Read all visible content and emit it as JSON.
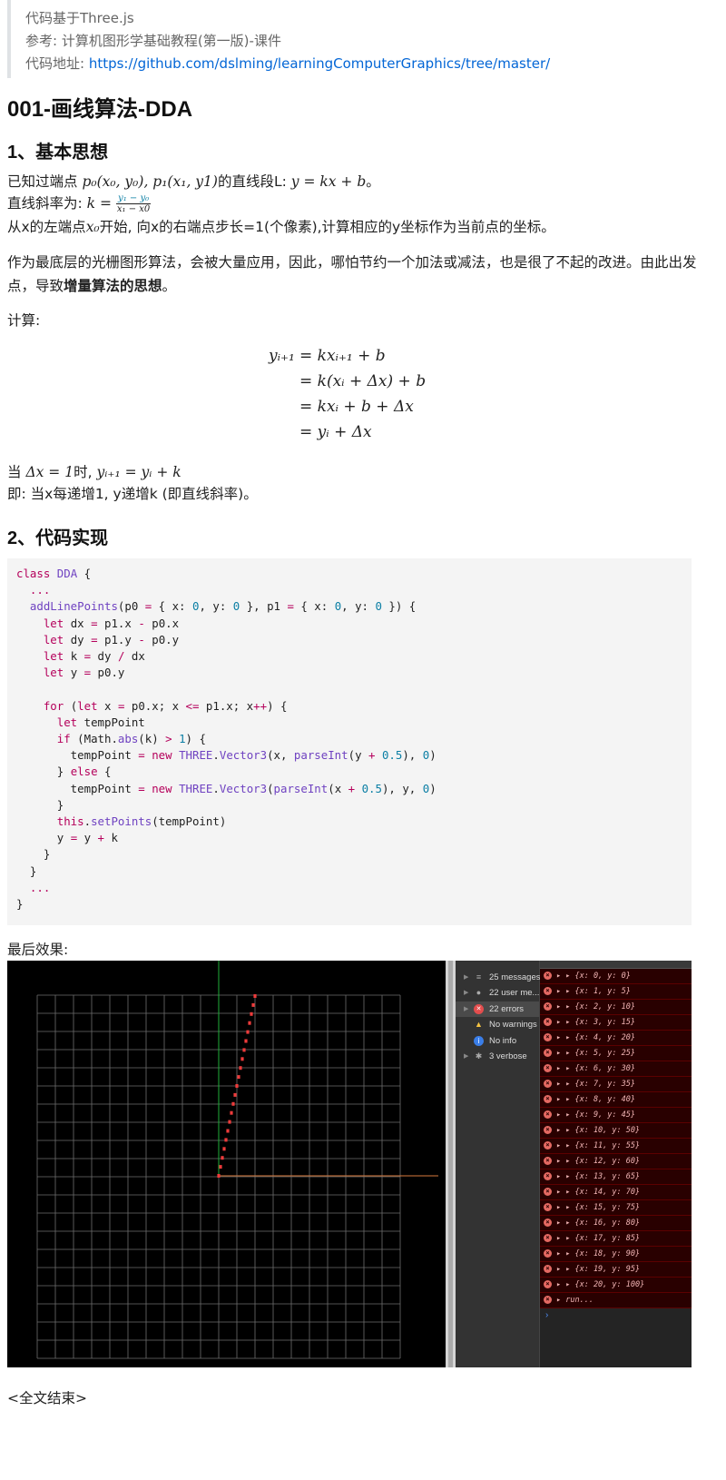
{
  "quote": {
    "line1": "代码基于Three.js",
    "line2": "参考: 计算机图形学基础教程(第一版)-课件",
    "line3_prefix": "代码地址: ",
    "line3_link": "https://github.com/dslming/learningComputerGraphics/tree/master/"
  },
  "title": "001-画线算法-DDA",
  "section1": {
    "heading": "1、基本思想",
    "line1_prefix": "已知过端点 ",
    "line1_math": "p₀(x₀, y₀), p₁(x₁, y1)",
    "line1_mid": "的直线段L: ",
    "line1_eq": "y = kx + b",
    "line1_end": "。",
    "line2_prefix": "直线斜率为: ",
    "line2_k": "k = ",
    "line2_num": "y₁ − y₀",
    "line2_den": "x₁ − x0",
    "line3_prefix": "从x的左端点",
    "line3_math": "x₀",
    "line3_rest": "开始, 向x的右端点步长=1(个像素),计算相应的y坐标作为当前点的坐标。",
    "para2_text": "作为最底层的光栅图形算法，会被大量应用，因此，哪怕节约一个加法或减法，也是很了不起的改进。由此出发点，导致",
    "para2_bold": "增量算法的思想",
    "para2_end": "。",
    "calc_label": "计算:",
    "equations": [
      {
        "lhs": "yᵢ₊₁",
        "rhs": "= kxᵢ₊₁ + b"
      },
      {
        "lhs": "",
        "rhs": "= k(xᵢ + Δx) + b"
      },
      {
        "lhs": "",
        "rhs": "= kxᵢ + b + Δx"
      },
      {
        "lhs": "",
        "rhs": "= yᵢ + Δx"
      }
    ],
    "when_prefix": "当 ",
    "when_math1": "Δx = 1",
    "when_mid": "时, ",
    "when_math2": "yᵢ₊₁ = yᵢ + k",
    "namely": "即: 当x每递增1, y递增k (即直线斜率)。"
  },
  "section2": {
    "heading": "2、代码实现",
    "result_label": "最后效果:"
  },
  "devtools": {
    "sidebar": [
      {
        "label": "25 messages",
        "icon": "list-icon"
      },
      {
        "label": "22 user me...",
        "icon": "user-icon"
      },
      {
        "label": "22 errors",
        "icon": "error-icon"
      },
      {
        "label": "No warnings",
        "icon": "warning-icon"
      },
      {
        "label": "No info",
        "icon": "info-icon"
      },
      {
        "label": "3 verbose",
        "icon": "bug-icon"
      }
    ],
    "logs": [
      "{x: 0, y: 0}",
      "{x: 1, y: 5}",
      "{x: 2, y: 10}",
      "{x: 3, y: 15}",
      "{x: 4, y: 20}",
      "{x: 5, y: 25}",
      "{x: 6, y: 30}",
      "{x: 7, y: 35}",
      "{x: 8, y: 40}",
      "{x: 9, y: 45}",
      "{x: 10, y: 50}",
      "{x: 11, y: 55}",
      "{x: 12, y: 60}",
      "{x: 13, y: 65}",
      "{x: 14, y: 70}",
      "{x: 15, y: 75}",
      "{x: 16, y: 80}",
      "{x: 17, y: 85}",
      "{x: 18, y: 90}",
      "{x: 19, y: 95}",
      "{x: 20, y: 100}"
    ],
    "last_log": "run...",
    "prompt": "›"
  },
  "ending": "<全文结束>"
}
